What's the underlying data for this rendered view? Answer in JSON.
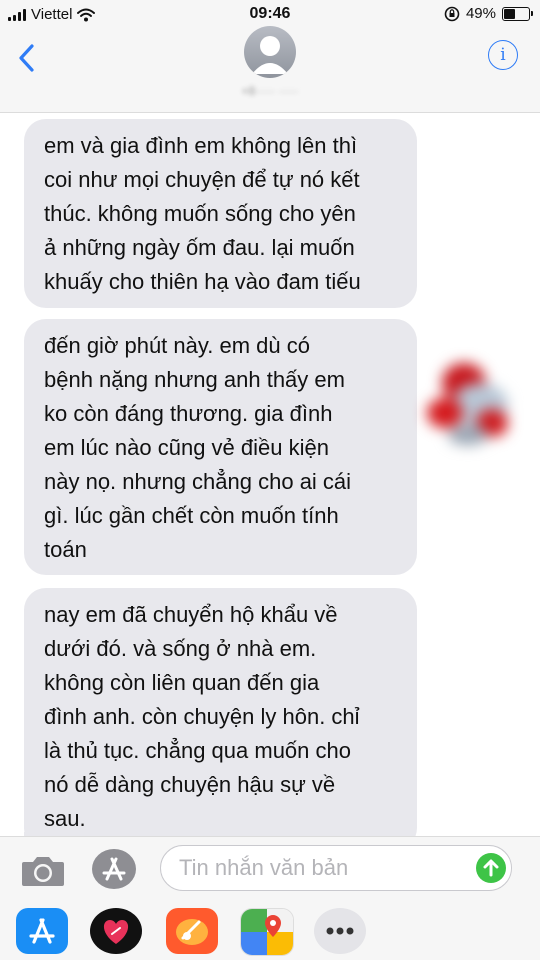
{
  "status_bar": {
    "carrier": "Viettel",
    "time": "09:46",
    "battery_percent": "49%",
    "battery_level": 0.49,
    "icons": [
      "signal-icon",
      "wifi-icon",
      "orientation-lock-icon",
      "battery-icon"
    ]
  },
  "header": {
    "contact_name": "+8·····  ·····",
    "icons": [
      "back-chevron-icon",
      "contact-avatar-icon",
      "info-icon"
    ],
    "info_glyph": "i"
  },
  "messages": [
    {
      "text": "em và gia đình em không lên thì\ncoi như mọi chuyện để tự nó kết\nthúc. không muốn sống cho yên\nả những ngày ốm đau. lại muốn\nkhuấy cho thiên hạ vào đam tiếu"
    },
    {
      "text": "đến giờ phút này. em dù có\nbệnh nặng nhưng anh thấy em\nko còn đáng thương. gia đình\nem lúc nào cũng  vẻ điều kiện\nnày nọ. nhưng chẳng cho ai cái\ngì. lúc gần chết còn muốn tính\ntoán"
    },
    {
      "text": "nay em đã chuyển hộ khẩu về\ndưới đó. và sống ở nhà em.\nkhông còn liên quan đến gia\nđình anh. còn chuyện ly hôn. chỉ\nlà thủ tục. chẳng qua muốn cho\nnó dễ dàng chuyện hậu sự về\nsau."
    }
  ],
  "input_bar": {
    "placeholder": "Tin nhắn văn bản",
    "icons": [
      "camera-icon",
      "app-store-icon",
      "send-arrow-icon"
    ]
  },
  "app_drawer": {
    "apps": [
      "app-store-icon",
      "digital-touch-icon",
      "music-app-icon",
      "google-maps-icon",
      "more-icon"
    ]
  },
  "colors": {
    "ios_blue": "#2f7cf6",
    "bubble_gray": "#e8e8ed",
    "send_green": "#3ec447",
    "bar_bg": "#f6f6f6"
  }
}
